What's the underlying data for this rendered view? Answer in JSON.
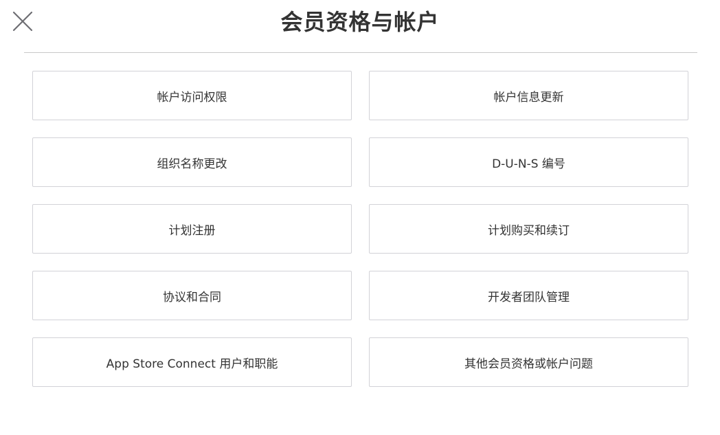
{
  "header": {
    "title": "会员资格与帐户",
    "close_icon": "close-icon"
  },
  "options": [
    {
      "label": "帐户访问权限"
    },
    {
      "label": "帐户信息更新"
    },
    {
      "label": "组织名称更改"
    },
    {
      "label": "D-U-N-S 编号"
    },
    {
      "label": "计划注册"
    },
    {
      "label": "计划购买和续订"
    },
    {
      "label": "协议和合同"
    },
    {
      "label": "开发者团队管理"
    },
    {
      "label": "App Store Connect 用户和职能"
    },
    {
      "label": "其他会员资格或帐户问题"
    }
  ],
  "colors": {
    "border": "#d2d2d7",
    "text": "#333333",
    "divider": "#c8c8c8"
  }
}
